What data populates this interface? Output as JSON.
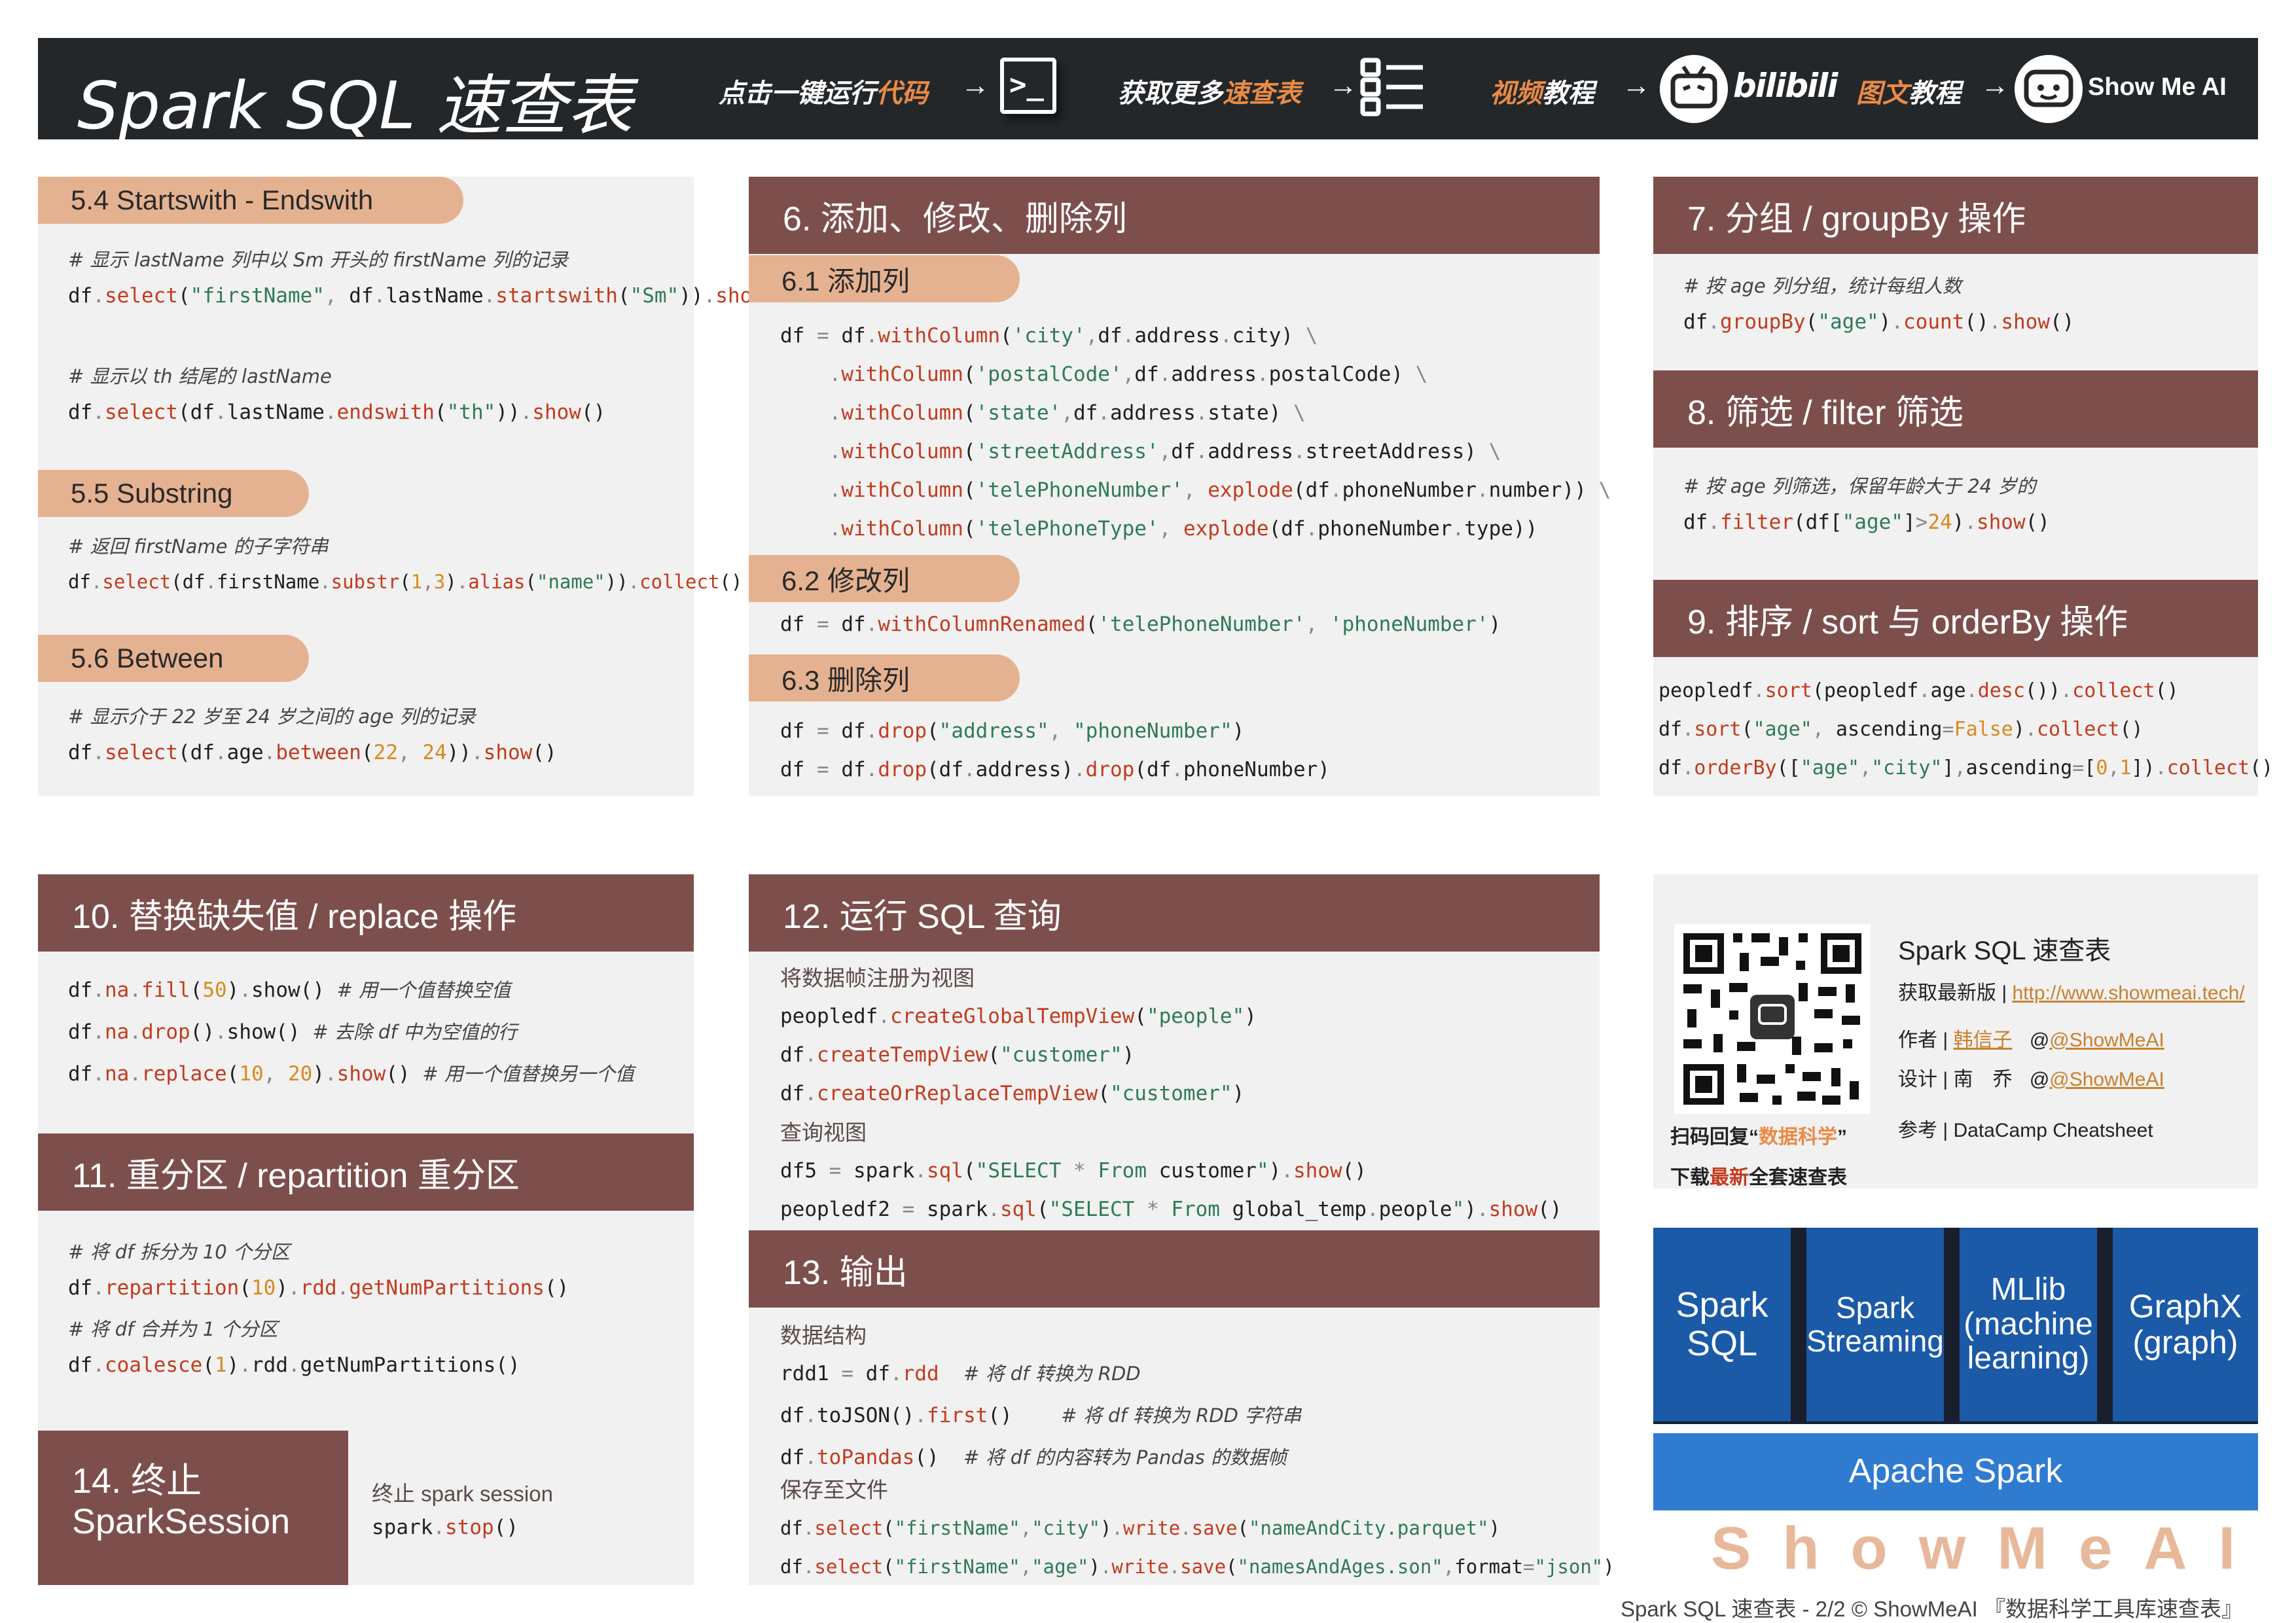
{
  "header": {
    "title": "Spark SQL 速查表",
    "run_code": {
      "part1": "点击一键运行",
      "part2": "代码",
      "arrow": "→"
    },
    "more_sheets": {
      "part1": "获取更多",
      "part2": "速查表",
      "arrow": "→"
    },
    "video": {
      "part1": "视频",
      "part2": "教程",
      "arrow": "→"
    },
    "bilibili": "bilibili",
    "article": {
      "part1": "图文",
      "part2": "教程",
      "arrow": "→"
    },
    "showmeai": "Show Me AI",
    "terminal_glyph": ">_",
    "icons": [
      "terminal-icon",
      "list-icon",
      "bilibili-icon",
      "showmeai-icon"
    ]
  },
  "sec5": {
    "s54": {
      "title": "5.4 Startswith - Endswith",
      "c1": "# 显示 lastName 列中以 Sm 开头的 firstName 列的记录",
      "c2": "# 显示以 th 结尾的 lastName"
    },
    "s55": {
      "title": "5.5 Substring",
      "c1": "# 返回 firstName 的子字符串"
    },
    "s56": {
      "title": "5.6 Between",
      "c1": "# 显示介于 22 岁至 24 岁之间的 age 列的记录"
    }
  },
  "sec6": {
    "title": "6. 添加、修改、删除列",
    "s61": "6.1 添加列",
    "s62": "6.2 修改列",
    "s63": "6.3 删除列"
  },
  "sec7": {
    "title": "7. 分组 / groupBy 操作",
    "c1": "# 按 age 列分组，统计每组人数"
  },
  "sec8": {
    "title": "8. 筛选 / filter 筛选",
    "c1": "# 按 age 列筛选，保留年龄大于 24 岁的"
  },
  "sec9": {
    "title": "9. 排序 / sort 与 orderBy 操作"
  },
  "sec10": {
    "title": "10. 替换缺失值 / replace 操作",
    "c1": "# 用一个值替换空值",
    "c2": "# 去除 df 中为空值的行",
    "c3": "# 用一个值替换另一个值"
  },
  "sec11": {
    "title": "11. 重分区 / repartition 重分区",
    "c1": "# 将 df 拆分为 10 个分区",
    "c2": "# 将 df 合并为 1 个分区"
  },
  "sec12": {
    "title": "12. 运行 SQL 查询",
    "l1": "将数据帧注册为视图",
    "l2": "查询视图"
  },
  "sec13": {
    "title": "13. 输出",
    "l1": "数据结构",
    "l2": "保存至文件",
    "c1": "# 将 df 转换为 RDD",
    "c2": "# 将 df 转换为 RDD 字符串",
    "c3": "# 将 df 的内容转为 Pandas 的数据帧"
  },
  "sec14": {
    "title_line1": "14. 终止",
    "title_line2": "SparkSession",
    "l1": "终止 spark session"
  },
  "info": {
    "title": "Spark SQL 速查表",
    "latest_label": "获取最新版 |",
    "latest_url": "http://www.showmeai.tech/",
    "author_label": "作者 |",
    "author_name": "韩信子",
    "author_handle": "@ShowMeAI",
    "design_label": "设计 | 南　乔",
    "design_handle": "@ShowMeAI",
    "ref_label": "参考 |",
    "ref_value": "DataCamp Cheatsheet",
    "scan_part1": "扫码回复“",
    "scan_part2": "数据科学",
    "scan_part3": "”",
    "download_part1": "下载",
    "download_part2": "最新",
    "download_part3": "全套速查表"
  },
  "stack": {
    "modules": [
      {
        "line1": "Spark",
        "line2": "SQL"
      },
      {
        "line1": "Spark",
        "line2": "Streaming"
      },
      {
        "line1": "MLlib",
        "line2": "(machine",
        "line3": "learning)"
      },
      {
        "line1": "GraphX",
        "line2": "(graph)"
      }
    ],
    "base": "Apache Spark",
    "watermark": "ShowMeAI"
  },
  "footer": "Spark SQL 速查表 - 2/2  © ShowMeAI 『数据科学工具库速查表』",
  "colors": {
    "banner": "#7d4f4c",
    "pill": "#e5b291",
    "header_bg": "#24272a",
    "accent": "#e98b46",
    "spark_blue": "#1a5aa7"
  }
}
